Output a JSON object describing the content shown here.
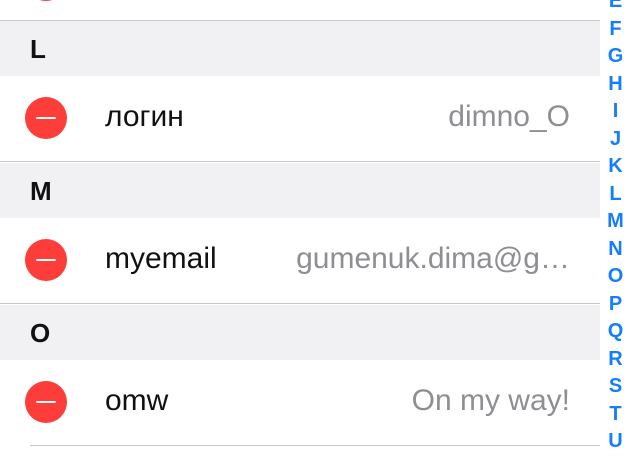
{
  "sections": [
    {
      "letter": "L",
      "rows": [
        {
          "shortcut": "логин",
          "phrase": "dimno_O"
        }
      ]
    },
    {
      "letter": "M",
      "rows": [
        {
          "shortcut": "myemail",
          "phrase": "gumenuk.dima@g…"
        }
      ]
    },
    {
      "letter": "O",
      "rows": [
        {
          "shortcut": "omw",
          "phrase": "On my way!"
        }
      ]
    }
  ],
  "index_letters": [
    "E",
    "F",
    "G",
    "H",
    "I",
    "J",
    "K",
    "L",
    "M",
    "N",
    "O",
    "P",
    "Q",
    "R",
    "S",
    "T",
    "U"
  ],
  "colors": {
    "delete": "#fc3d39",
    "index": "#147efb",
    "section_bg": "#f1f1f3",
    "separator": "#c8c7cc",
    "phrase_text": "#8e8e93"
  },
  "icons": {
    "delete": "minus-circle-icon"
  }
}
